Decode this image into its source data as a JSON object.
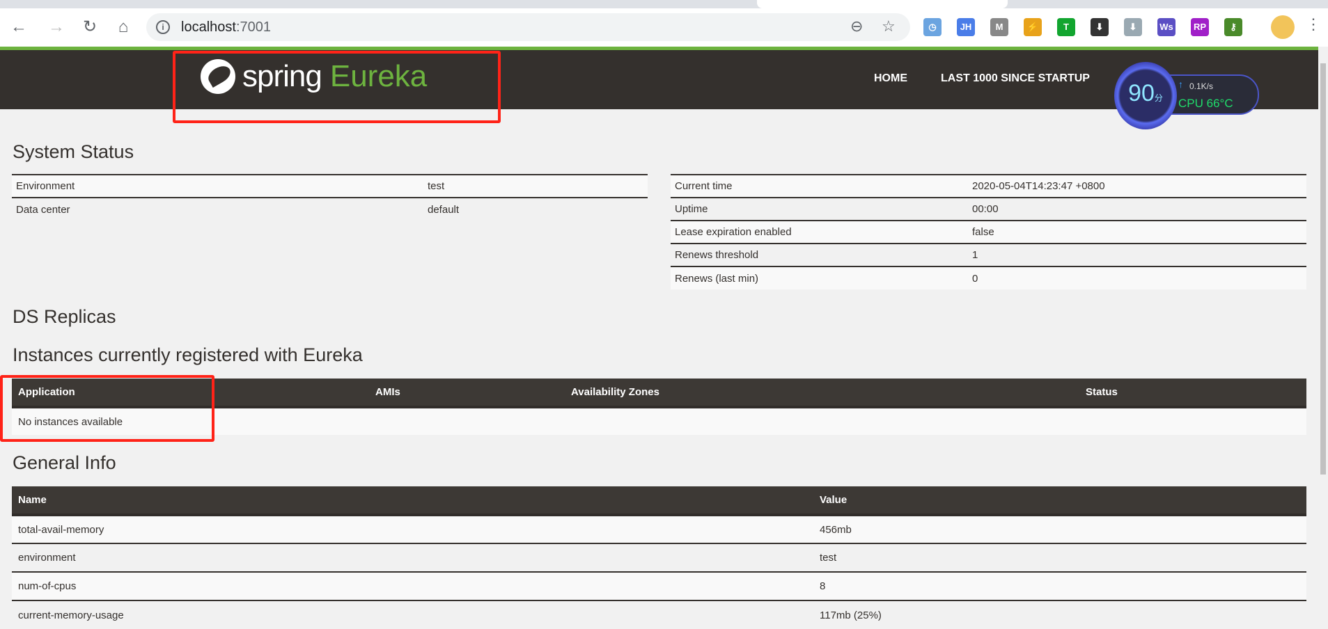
{
  "browser": {
    "url_host": "localhost",
    "url_port": ":7001",
    "icons": [
      "back-icon",
      "forward-icon",
      "reload-icon",
      "home-icon",
      "zoom-out-icon",
      "bookmark-star-icon"
    ],
    "extensions": [
      {
        "name": "clock-extension",
        "label": "◷",
        "color": "#6ba4e0"
      },
      {
        "name": "jh-extension",
        "label": "JH",
        "color": "#4a7de8"
      },
      {
        "name": "gmail-checker-extension",
        "label": "M",
        "color": "#888888"
      },
      {
        "name": "lightning-extension",
        "label": "⚡",
        "color": "#e8a21a"
      },
      {
        "name": "tampermonkey-extension",
        "label": "T",
        "color": "#12a52f"
      },
      {
        "name": "download-extension",
        "label": "⬇",
        "color": "#333333"
      },
      {
        "name": "download-grey-extension",
        "label": "⬇",
        "color": "#9aa9b2"
      },
      {
        "name": "ws-extension",
        "label": "Ws",
        "color": "#5b4fc4"
      },
      {
        "name": "rp-extension",
        "label": "RP",
        "color": "#a020c8"
      },
      {
        "name": "key-extension",
        "label": "⚷",
        "color": "#4a8a2a"
      }
    ]
  },
  "header": {
    "logo_word1": "spring",
    "logo_word2": "Eureka",
    "nav": [
      "HOME",
      "LAST 1000 SINCE STARTUP"
    ]
  },
  "widget": {
    "score": "90",
    "score_unit": "分",
    "net": "0.1K/s",
    "cpu": "CPU 66°C"
  },
  "system_status": {
    "title": "System Status",
    "left": [
      {
        "k": "Environment",
        "v": "test"
      },
      {
        "k": "Data center",
        "v": "default"
      }
    ],
    "right": [
      {
        "k": "Current time",
        "v": "2020-05-04T14:23:47 +0800"
      },
      {
        "k": "Uptime",
        "v": "00:00"
      },
      {
        "k": "Lease expiration enabled",
        "v": "false"
      },
      {
        "k": "Renews threshold",
        "v": "1"
      },
      {
        "k": "Renews (last min)",
        "v": "0"
      }
    ]
  },
  "ds_replicas": {
    "title": "DS Replicas"
  },
  "instances": {
    "title": "Instances currently registered with Eureka",
    "columns": [
      "Application",
      "AMIs",
      "Availability Zones",
      "Status"
    ],
    "empty": "No instances available"
  },
  "general_info": {
    "title": "General Info",
    "columns": [
      "Name",
      "Value"
    ],
    "rows": [
      {
        "k": "total-avail-memory",
        "v": "456mb"
      },
      {
        "k": "environment",
        "v": "test"
      },
      {
        "k": "num-of-cpus",
        "v": "8"
      },
      {
        "k": "current-memory-usage",
        "v": "117mb (25%)"
      }
    ]
  }
}
